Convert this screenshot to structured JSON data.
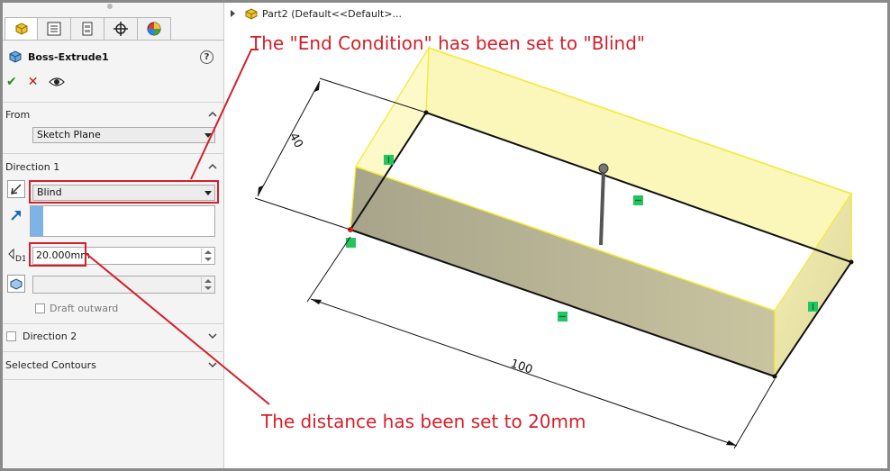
{
  "feature": {
    "title": "Boss-Extrude1",
    "help": "?"
  },
  "actions": {
    "ok": "✔",
    "cancel": "✕"
  },
  "from": {
    "title": "From",
    "value": "Sketch Plane"
  },
  "direction1": {
    "title": "Direction 1",
    "end_condition": "Blind",
    "depth": "20.000mm",
    "draft_outward": "Draft outward"
  },
  "direction2": {
    "title": "Direction 2"
  },
  "selected_contours": {
    "title": "Selected Contours"
  },
  "tree": {
    "label": "Part2  (Default<<Default>..."
  },
  "annotations": {
    "top": "The \"End Condition\" has been set to \"Blind\"",
    "bottom": "The distance has been set to 20mm"
  },
  "dimensions": {
    "width": "40",
    "length": "100"
  },
  "colors": {
    "annotation": "#d4202a",
    "box_edge": "#f2ea3a",
    "box_fill": "#fbf7b4",
    "side_face": "#a8a58a",
    "relation": "#22c55e"
  }
}
